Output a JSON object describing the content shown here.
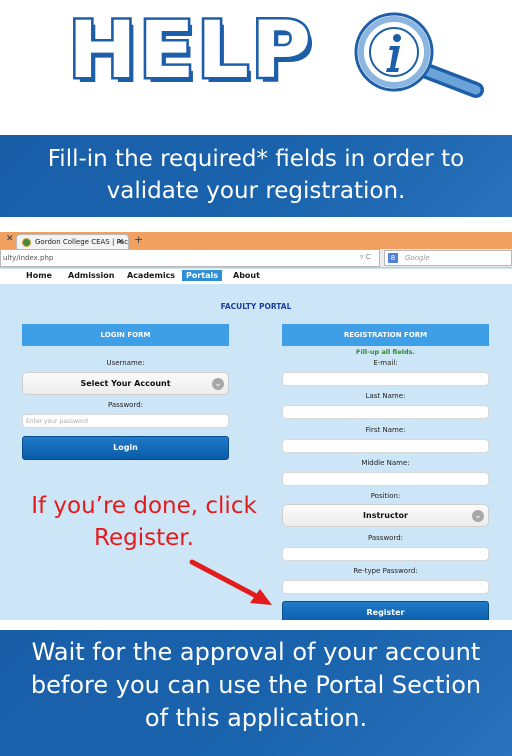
{
  "header": {
    "title": "HELP"
  },
  "banner_top": {
    "line1": "Fill-in the required* fields in order to",
    "line2": "validate your registration."
  },
  "browser": {
    "tab_title": "Gordon College CEAS | Fac...",
    "url": "ulty/index.php",
    "search_placeholder": "Google",
    "search_engine_letter": "8",
    "nav": [
      "Home",
      "Admission",
      "Academics",
      "Portals",
      "About"
    ]
  },
  "page": {
    "portal_title": "FACULTY PORTAL",
    "login": {
      "heading": "LOGIN FORM",
      "username_label": "Username:",
      "account_select": "Select Your Account",
      "password_label": "Password:",
      "password_placeholder": "Enter your password",
      "login_button": "Login"
    },
    "registration": {
      "heading": "REGISTRATION FORM",
      "hint": "Fill-up all fields.",
      "email_label": "E-mail:",
      "last_name_label": "Last Name:",
      "first_name_label": "First Name:",
      "middle_name_label": "Middle Name:",
      "position_label": "Position:",
      "position_value": "Instructor",
      "password_label": "Password:",
      "retype_label": "Re-type Password:",
      "register_button": "Register"
    }
  },
  "annotation": {
    "line1": "If you’re done, click",
    "line2": "Register."
  },
  "banner_bottom": {
    "line1": "Wait for the approval of your account",
    "line2": "before you can use the Portal Section",
    "line3": "of this application."
  },
  "colors": {
    "banner_blue": "#1a63ad",
    "form_head_blue": "#3e9ee6",
    "annotation_red": "#e21b1b",
    "page_bg": "#cde6f7"
  }
}
